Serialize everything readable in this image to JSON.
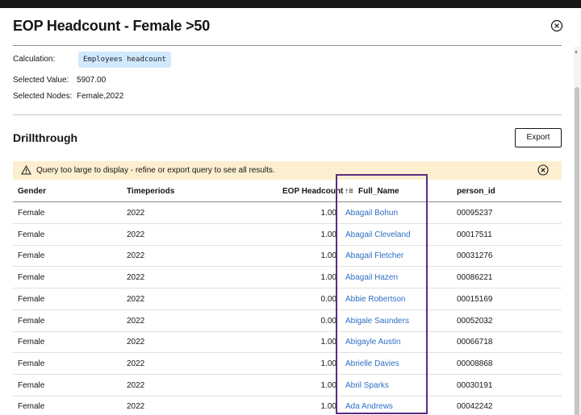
{
  "modal": {
    "title": "EOP Headcount - Female >50"
  },
  "details": {
    "calculation_label": "Calculation:",
    "calculation_value": "Employees headcount",
    "selected_value_label": "Selected Value:",
    "selected_value": "5907.00",
    "selected_nodes_label": "Selected Nodes:",
    "selected_nodes": "Female,2022"
  },
  "drillthrough": {
    "title": "Drillthrough",
    "export_label": "Export",
    "warning": "Query too large to display - refine or export query to see all results.",
    "sort_indicator": "↑≡",
    "columns": [
      "Gender",
      "Timeperiods",
      "EOP Headcount",
      "Full_Name",
      "person_id"
    ],
    "rows": [
      {
        "gender": "Female",
        "period": "2022",
        "headcount": "1.00",
        "name": "Abagail Bohun",
        "id": "00095237"
      },
      {
        "gender": "Female",
        "period": "2022",
        "headcount": "1.00",
        "name": "Abagail Cleveland",
        "id": "00017511"
      },
      {
        "gender": "Female",
        "period": "2022",
        "headcount": "1.00",
        "name": "Abagail Fletcher",
        "id": "00031276"
      },
      {
        "gender": "Female",
        "period": "2022",
        "headcount": "1.00",
        "name": "Abagail Hazen",
        "id": "00086221"
      },
      {
        "gender": "Female",
        "period": "2022",
        "headcount": "0.00",
        "name": "Abbie Robertson",
        "id": "00015169"
      },
      {
        "gender": "Female",
        "period": "2022",
        "headcount": "0.00",
        "name": "Abigale Saunders",
        "id": "00052032"
      },
      {
        "gender": "Female",
        "period": "2022",
        "headcount": "1.00",
        "name": "Abigayle Austin",
        "id": "00066718"
      },
      {
        "gender": "Female",
        "period": "2022",
        "headcount": "1.00",
        "name": "Abrielle Davies",
        "id": "00008868"
      },
      {
        "gender": "Female",
        "period": "2022",
        "headcount": "1.00",
        "name": "Abril Sparks",
        "id": "00030191"
      },
      {
        "gender": "Female",
        "period": "2022",
        "headcount": "1.00",
        "name": "Ada Andrews",
        "id": "00042242"
      }
    ]
  },
  "colors": {
    "link": "#2f6fc4",
    "tag_bg": "#d0e9ff",
    "warning_bg": "#fcefcf",
    "highlight": "#5a2a82"
  }
}
